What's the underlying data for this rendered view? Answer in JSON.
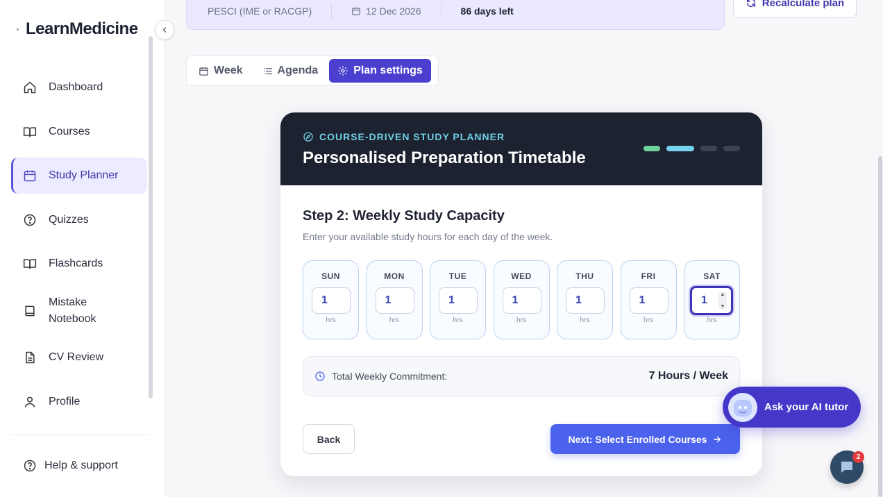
{
  "brand": {
    "name": "LearnMedicine"
  },
  "sidebar": {
    "items": [
      {
        "label": "Dashboard",
        "icon": "home-icon"
      },
      {
        "label": "Courses",
        "icon": "book-open-icon"
      },
      {
        "label": "Study Planner",
        "icon": "calendar-icon",
        "active": true
      },
      {
        "label": "Quizzes",
        "icon": "question-circle-icon"
      },
      {
        "label": "Flashcards",
        "icon": "book-open-icon"
      },
      {
        "label": "Mistake Notebook",
        "icon": "notebook-icon"
      },
      {
        "label": "CV Review",
        "icon": "document-icon"
      },
      {
        "label": "Profile",
        "icon": "user-icon"
      }
    ],
    "help_label": "Help & support"
  },
  "banner": {
    "exam": "PESCI (IME or RACGP)",
    "date": "12 Dec 2026",
    "days_left": "86 days left"
  },
  "recalculate_label": "Recalculate plan",
  "tabs": [
    {
      "label": "Week",
      "icon": "calendar-icon"
    },
    {
      "label": "Agenda",
      "icon": "list-icon"
    },
    {
      "label": "Plan settings",
      "icon": "gear-icon",
      "active": true
    }
  ],
  "card": {
    "eyebrow": "COURSE-DRIVEN STUDY PLANNER",
    "title": "Personalised Preparation Timetable",
    "step_title": "Step 2: Weekly Study Capacity",
    "step_desc": "Enter your available study hours for each day of the week.",
    "days": [
      {
        "label": "SUN",
        "value": "1",
        "unit": "hrs"
      },
      {
        "label": "MON",
        "value": "1",
        "unit": "hrs"
      },
      {
        "label": "TUE",
        "value": "1",
        "unit": "hrs"
      },
      {
        "label": "WED",
        "value": "1",
        "unit": "hrs"
      },
      {
        "label": "THU",
        "value": "1",
        "unit": "hrs"
      },
      {
        "label": "FRI",
        "value": "1",
        "unit": "hrs"
      },
      {
        "label": "SAT",
        "value": "1",
        "unit": "hrs"
      }
    ],
    "total_label": "Total Weekly Commitment:",
    "total_value": "7 Hours / Week",
    "back_label": "Back",
    "next_label": "Next: Select Enrolled Courses"
  },
  "ai_tutor_label": "Ask your AI tutor",
  "chat_badge": "2",
  "colors": {
    "accent": "#4b3fd0",
    "next_button": "#4b62ec",
    "card_header": "#1d2230"
  }
}
